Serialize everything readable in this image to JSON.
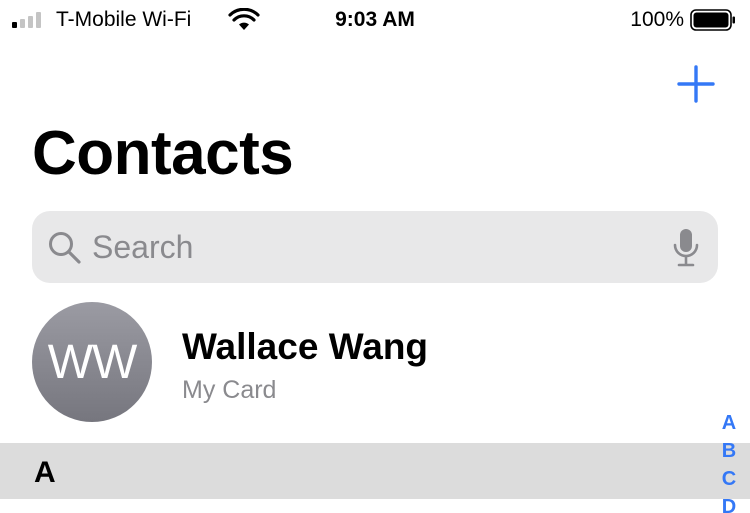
{
  "status_bar": {
    "carrier": "T-Mobile Wi-Fi",
    "time": "9:03 AM",
    "battery_percent": "100%",
    "battery_level": 1.0,
    "signal_bars_filled": 1
  },
  "nav": {
    "add_icon": "plus-icon",
    "accent_color": "#3478f6"
  },
  "header": {
    "title": "Contacts"
  },
  "search": {
    "placeholder": "Search",
    "value": "",
    "icons": [
      "search-icon",
      "mic-icon"
    ]
  },
  "my_card": {
    "initials": "WW",
    "name": "Wallace Wang",
    "subtitle": "My Card"
  },
  "sections": [
    {
      "letter": "A"
    }
  ],
  "index": [
    "A",
    "B",
    "C",
    "D"
  ]
}
